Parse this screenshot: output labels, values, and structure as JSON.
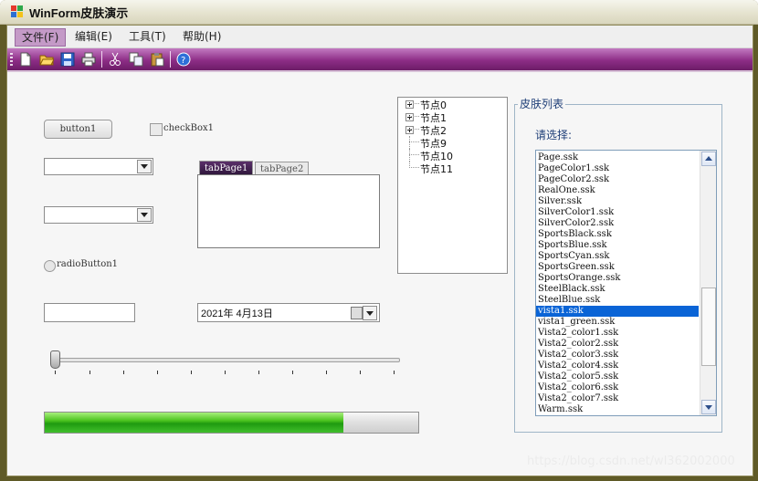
{
  "window": {
    "title": "WinForm皮肤演示"
  },
  "menu": {
    "items": [
      "文件(F)",
      "编辑(E)",
      "工具(T)",
      "帮助(H)"
    ],
    "active_index": 0
  },
  "toolbar": {
    "icons": [
      "new-file-icon",
      "open-folder-icon",
      "save-icon",
      "print-icon",
      "cut-icon",
      "copy-icon",
      "paste-icon",
      "help-icon"
    ]
  },
  "controls": {
    "button_label": "button1",
    "checkbox_label": "checkBox1",
    "radio_label": "radioButton1",
    "tabs": [
      "tabPage1",
      "tabPage2"
    ],
    "selected_tab": "tabPage1",
    "date_value": "2021年  4月13日",
    "progress_percent": 80,
    "slider_value": 0
  },
  "tree": {
    "nodes": [
      {
        "label": "节点0",
        "expandable": true
      },
      {
        "label": "节点1",
        "expandable": true
      },
      {
        "label": "节点2",
        "expandable": true
      },
      {
        "label": "节点9",
        "expandable": false
      },
      {
        "label": "节点10",
        "expandable": false
      },
      {
        "label": "节点11",
        "expandable": false
      }
    ]
  },
  "skin_panel": {
    "title": "皮肤列表",
    "prompt": "请选择:",
    "selected": "vista1.ssk",
    "items": [
      "Page.ssk",
      "PageColor1.ssk",
      "PageColor2.ssk",
      "RealOne.ssk",
      "Silver.ssk",
      "SilverColor1.ssk",
      "SilverColor2.ssk",
      "SportsBlack.ssk",
      "SportsBlue.ssk",
      "SportsCyan.ssk",
      "SportsGreen.ssk",
      "SportsOrange.ssk",
      "SteelBlack.ssk",
      "SteelBlue.ssk",
      "vista1.ssk",
      "vista1_green.ssk",
      "Vista2_color1.ssk",
      "Vista2_color2.ssk",
      "Vista2_color3.ssk",
      "Vista2_color4.ssk",
      "Vista2_color5.ssk",
      "Vista2_color6.ssk",
      "Vista2_color7.ssk",
      "Warm.ssk"
    ]
  },
  "watermark": "https://blog.csdn.net/wl362002000"
}
